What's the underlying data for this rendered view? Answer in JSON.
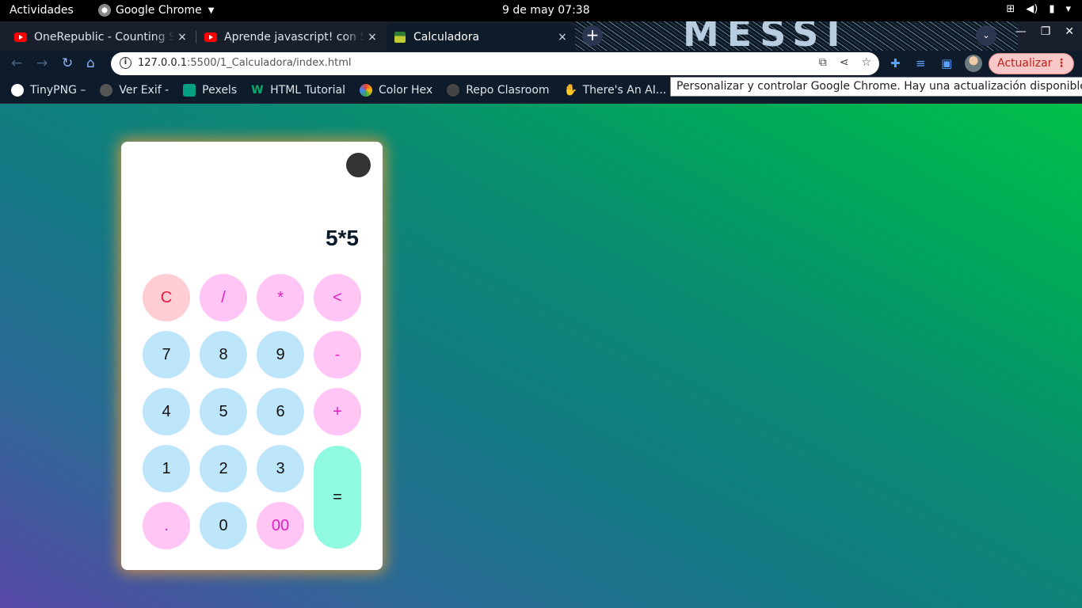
{
  "system": {
    "activities": "Actividades",
    "app_menu": "Google Chrome",
    "clock": "9 de may  07:38"
  },
  "tabs": [
    {
      "label": "OneRepublic - Counting S",
      "icon": "youtube-icon"
    },
    {
      "label": "Aprende javascript! con 5",
      "icon": "youtube-icon"
    },
    {
      "label": "Calculadora",
      "icon": "calculator-icon",
      "active": true
    }
  ],
  "tab_close_glyph": "×",
  "toolbar": {
    "url_host": "127.0.0.1",
    "url_path": ":5500/1_Calculadora/index.html",
    "update_label": "Actualizar"
  },
  "bookmarks": [
    {
      "label": "TinyPNG –",
      "color": "#ffffff"
    },
    {
      "label": "Ver Exif -",
      "color": "#555555"
    },
    {
      "label": "Pexels",
      "color": "#05a081"
    },
    {
      "label": "HTML Tutorial",
      "color": "#04aa6d"
    },
    {
      "label": "Color Hex",
      "color": "#f4b400"
    },
    {
      "label": "Repo Clasroom",
      "color": "#444444"
    },
    {
      "label": "There's An AI...",
      "color": "#dddddd"
    }
  ],
  "tooltip": "Personalizar y controlar Google Chrome. Hay una actualización disponible.",
  "calculator": {
    "display": "5*5",
    "keys": {
      "clear": "C",
      "divide": "/",
      "multiply": "*",
      "backspace": "<",
      "seven": "7",
      "eight": "8",
      "nine": "9",
      "minus": "-",
      "four": "4",
      "five": "5",
      "six": "6",
      "plus": "+",
      "one": "1",
      "two": "2",
      "three": "3",
      "equals": "=",
      "dot": ".",
      "zero": "0",
      "double_zero": "00"
    }
  },
  "colors": {
    "key_number": "#bee6fb",
    "key_operator": "#ffc6f5",
    "key_clear": "#ffcdd4",
    "key_equals": "#8ffadf"
  }
}
